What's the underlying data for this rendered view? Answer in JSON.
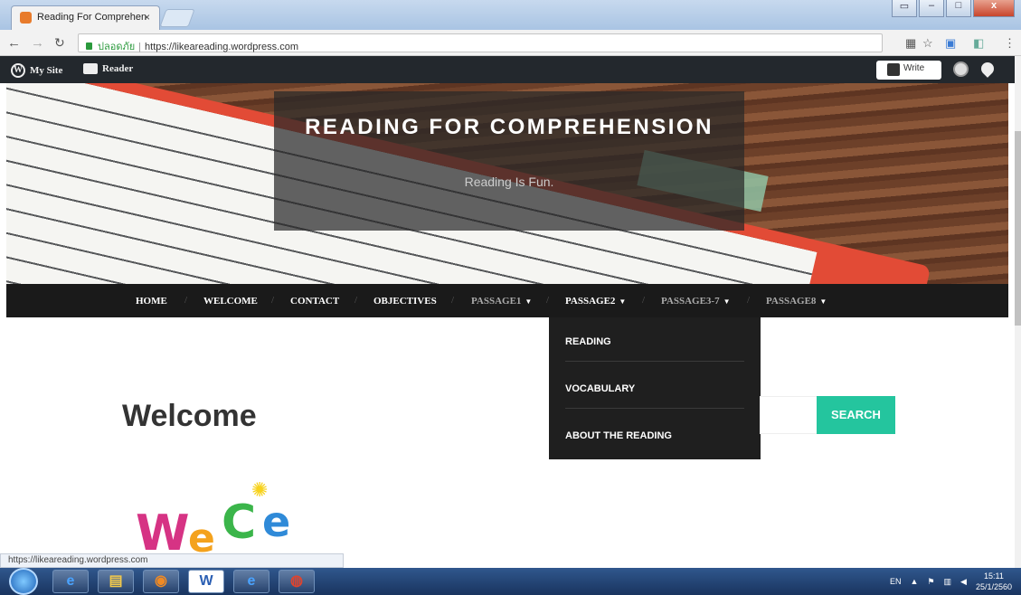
{
  "browser": {
    "tab_title": "Reading For Comprehen",
    "tab_close": "×",
    "secure_label": "ปลอดภัย",
    "url": "https://likeareading.wordpress.com",
    "status_url": "https://likeareading.wordpress.com"
  },
  "wpbar": {
    "my_site": "My Site",
    "reader": "Reader",
    "write": "Write"
  },
  "site": {
    "title": "READING FOR COMPREHENSION",
    "tagline": "Reading Is Fun."
  },
  "menu": {
    "items": [
      {
        "label": "HOME"
      },
      {
        "label": "WELCOME"
      },
      {
        "label": "CONTACT"
      },
      {
        "label": "OBJECTIVES"
      },
      {
        "label": "PASSAGE1"
      },
      {
        "label": "PASSAGE2"
      },
      {
        "label": "PASSAGE3-7"
      },
      {
        "label": "PASSAGE8"
      }
    ]
  },
  "dropdown": {
    "items": [
      {
        "label": "READING"
      },
      {
        "label": "VOCABULARY"
      },
      {
        "label": "ABOUT THE READING"
      }
    ]
  },
  "content": {
    "heading": "Welcome",
    "search_button": "SEARCH"
  },
  "taskbar": {
    "lang": "EN",
    "time": "15:11",
    "date": "25/1/2560"
  },
  "colors": {
    "accent": "#24c59e",
    "menu_bg": "#1a1a1a",
    "wpbar_bg": "#23282d"
  }
}
